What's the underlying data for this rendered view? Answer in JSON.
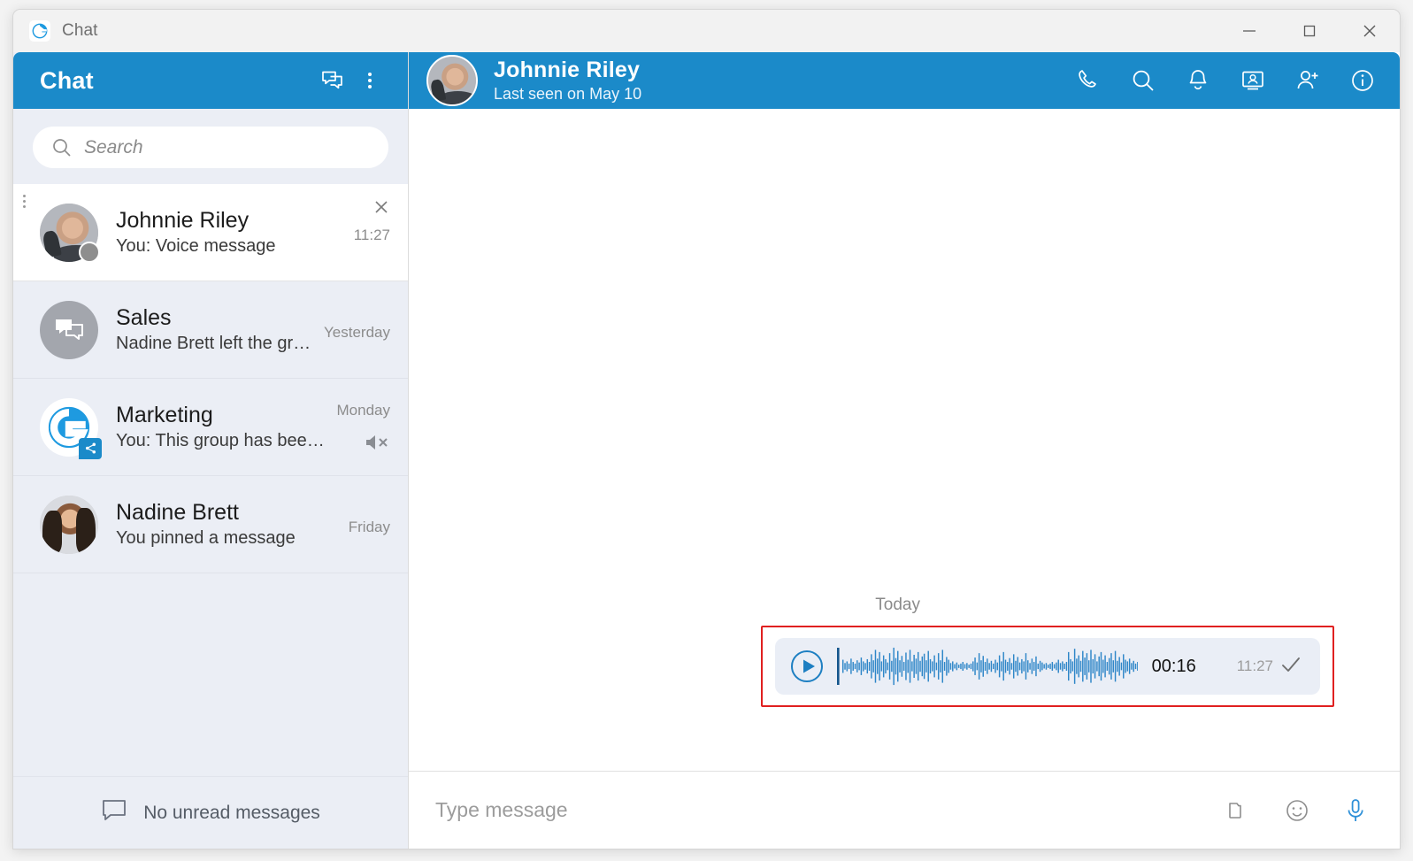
{
  "window": {
    "title": "Chat",
    "logo_icon": "g-logo-icon",
    "controls": {
      "minimize": "minimize-icon",
      "maximize": "maximize-icon",
      "close": "close-icon"
    }
  },
  "sidebar": {
    "header": {
      "title": "Chat",
      "new_chat_icon": "new-chat-icon",
      "menu_icon": "more-vertical-icon"
    },
    "search": {
      "placeholder": "Search",
      "value": "",
      "icon": "search-icon"
    },
    "chats": [
      {
        "name": "Johnnie Riley",
        "preview": "You: Voice message",
        "time": "11:27",
        "selected": true,
        "avatar_type": "photo-male",
        "status": "away",
        "muted": false,
        "has_close": true,
        "has_row_menu": true
      },
      {
        "name": "Sales",
        "preview": "Nadine Brett left the group",
        "time": "Yesterday",
        "selected": false,
        "avatar_type": "group-icon",
        "muted": false,
        "has_close": false,
        "has_row_menu": false
      },
      {
        "name": "Marketing",
        "preview": "You: This group has been tran...",
        "time": "Monday",
        "selected": false,
        "avatar_type": "g-logo",
        "muted": true,
        "mute_icon": "speaker-muted-icon",
        "badge_icon": "share-icon",
        "has_close": false,
        "has_row_menu": false
      },
      {
        "name": "Nadine Brett",
        "preview": "You pinned a message",
        "time": "Friday",
        "selected": false,
        "avatar_type": "photo-female",
        "muted": false,
        "has_close": false,
        "has_row_menu": false
      }
    ],
    "footer": {
      "unread_text": "No unread messages",
      "icon": "chat-bubble-icon"
    }
  },
  "chat_header": {
    "contact_name": "Johnnie Riley",
    "status_text": "Last seen on May 10",
    "avatar_type": "photo-male",
    "actions": [
      {
        "icon": "phone-icon",
        "label": "Call"
      },
      {
        "icon": "search-icon",
        "label": "Search"
      },
      {
        "icon": "bell-icon",
        "label": "Notifications"
      },
      {
        "icon": "screen-share-icon",
        "label": "Screen share"
      },
      {
        "icon": "add-person-icon",
        "label": "Add person"
      },
      {
        "icon": "info-icon",
        "label": "Info"
      }
    ]
  },
  "conversation": {
    "day_label": "Today",
    "highlight_color": "#e02020",
    "message": {
      "type": "voice",
      "play_icon": "play-circle-icon",
      "duration": "00:16",
      "time": "11:27",
      "status_icon": "check-icon",
      "outgoing": true,
      "waveform": [
        12,
        6,
        9,
        5,
        14,
        8,
        5,
        11,
        7,
        16,
        9,
        6,
        13,
        8,
        22,
        11,
        30,
        14,
        26,
        9,
        20,
        13,
        7,
        24,
        10,
        34,
        15,
        28,
        11,
        19,
        8,
        25,
        12,
        30,
        9,
        21,
        14,
        26,
        10,
        18,
        23,
        11,
        28,
        13,
        9,
        20,
        7,
        24,
        11,
        30,
        8,
        17,
        12,
        6,
        9,
        4,
        7,
        3,
        5,
        8,
        4,
        6,
        3,
        5,
        9,
        16,
        7,
        24,
        11,
        19,
        8,
        14,
        6,
        10,
        5,
        12,
        7,
        20,
        9,
        26,
        12,
        8,
        15,
        6,
        22,
        10,
        17,
        7,
        13,
        9,
        24,
        11,
        6,
        14,
        8,
        18,
        5,
        10,
        7,
        4,
        6,
        3,
        5,
        8,
        4,
        7,
        12,
        6,
        9,
        5,
        8,
        26,
        13,
        9,
        32,
        14,
        20,
        10,
        28,
        16,
        24,
        11,
        30,
        13,
        22,
        9,
        18,
        26,
        12,
        20,
        8,
        15,
        24,
        11,
        28,
        10,
        17,
        7,
        22,
        12,
        9,
        14,
        6,
        10,
        5,
        8,
        4,
        6
      ]
    }
  },
  "composer": {
    "placeholder": "Type message",
    "value": "",
    "actions": [
      {
        "icon": "attach-folder-icon",
        "label": "Attach file"
      },
      {
        "icon": "emoji-icon",
        "label": "Emoji"
      },
      {
        "icon": "microphone-icon",
        "label": "Record voice"
      }
    ]
  },
  "colors": {
    "accent_blue": "#1b8ac9",
    "sidebar_bg": "#ebeef5",
    "bubble_bg": "#eaeef6",
    "waveform": "#2e86c8",
    "highlight_red": "#e02020"
  }
}
